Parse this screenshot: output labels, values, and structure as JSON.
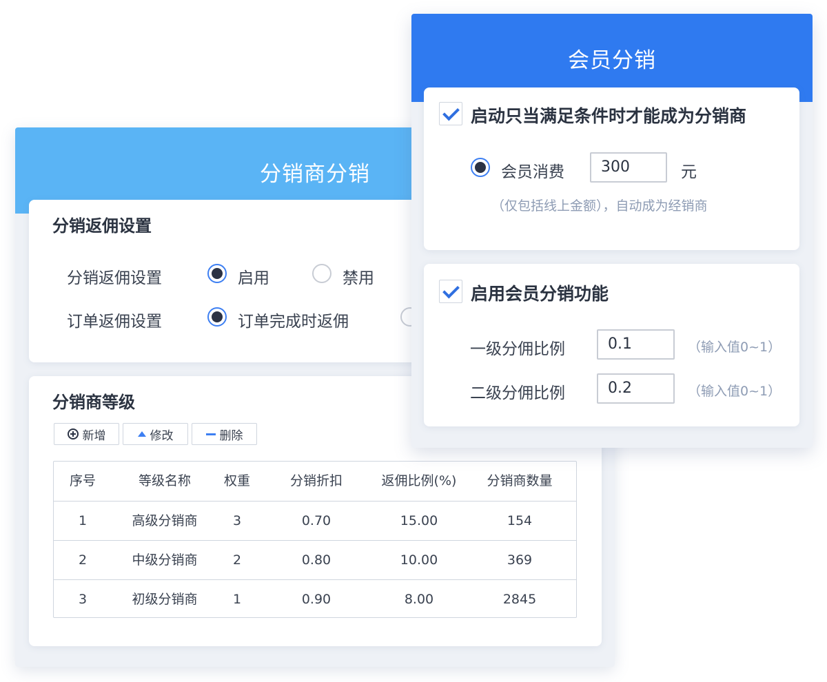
{
  "distributor_panel": {
    "title": "分销商分销",
    "settings": {
      "title": "分销返佣设置",
      "rows": [
        {
          "label": "分销返佣设置",
          "options": [
            "启用",
            "禁用"
          ],
          "selected": "启用"
        },
        {
          "label": "订单返佣设置",
          "options": [
            "订单完成时返佣"
          ],
          "selected": "订单完成时返佣"
        }
      ]
    },
    "levels": {
      "title": "分销商等级",
      "toolbar": {
        "add": "新增",
        "edit": "修改",
        "delete": "删除"
      },
      "columns": [
        "序号",
        "等级名称",
        "权重",
        "分销折扣",
        "返佣比例(%)",
        "分销商数量"
      ],
      "rows": [
        [
          "1",
          "高级分销商",
          "3",
          "0.70",
          "15.00",
          "154"
        ],
        [
          "2",
          "中级分销商",
          "2",
          "0.80",
          "10.00",
          "369"
        ],
        [
          "3",
          "初级分销商",
          "1",
          "0.90",
          "8.00",
          "2845"
        ]
      ]
    }
  },
  "member_panel": {
    "title": "会员分销",
    "condition": {
      "checked": true,
      "label": "启动只当满足条件时才能成为分销商",
      "option_label": "会员消费",
      "amount": "300",
      "unit": "元",
      "hint": "（仅包括线上金额），自动成为经销商"
    },
    "member_distribution": {
      "checked": true,
      "label": "启用会员分销功能",
      "fields": [
        {
          "label": "一级分佣比例",
          "value": "0.1",
          "hint": "（输入值0~1）"
        },
        {
          "label": "二级分佣比例",
          "value": "0.2",
          "hint": "（输入值0~1）"
        }
      ]
    }
  },
  "colors": {
    "distributor_header": "#5ab4f5",
    "member_header": "#2f7af0",
    "accent": "#3d7ff2"
  }
}
